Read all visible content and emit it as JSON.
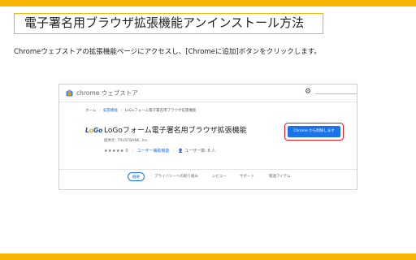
{
  "slide": {
    "title": "電子署名用ブラウザ拡張機能アンインストール方法",
    "description": "Chromeウェブストアの拡張機能ページにアクセスし、[Chromeに追加]ボタンをクリックします。"
  },
  "store": {
    "name": "chrome ウェブストア",
    "breadcrumb": [
      "ホーム",
      "拡張機能",
      "LoGoフォーム電子署名用ブラウザ拡張機能"
    ],
    "breadcrumb_separator": "›"
  },
  "extension": {
    "logo_text_pre": "L",
    "logo_text_o": "o",
    "logo_text_post": "Go",
    "name": "LoGoフォーム電子署名用ブラウザ拡張機能",
    "provider": "提供元: TRUSTBANK, Inc.",
    "stars": "★★★★★",
    "rating_count": "0",
    "category": "ユーザー補助機能",
    "users": "ユーザー数: 8 人",
    "add_button": "Chrome から削除します"
  },
  "tabs": [
    "概要",
    "プライバシーへの取り組み",
    "レビュー",
    "サポート",
    "関連アイテム"
  ],
  "colors": {
    "accent": "#f4b400",
    "button": "#1a73e8",
    "highlight": "#e01b24"
  }
}
